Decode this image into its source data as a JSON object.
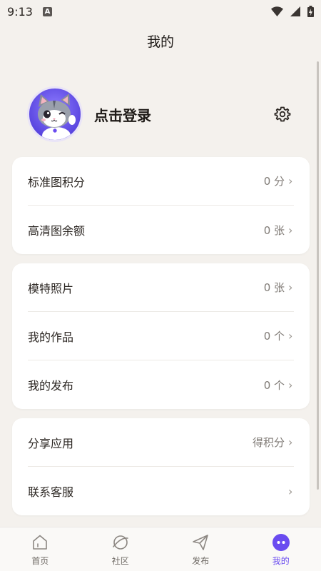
{
  "status": {
    "time": "9:13",
    "notification_letter": "A"
  },
  "header": {
    "title": "我的"
  },
  "profile": {
    "login_label": "点击登录",
    "avatar_icon": "cat-avatar-icon"
  },
  "cards": [
    {
      "rows": [
        {
          "label": "标准图积分",
          "value": "0 分"
        },
        {
          "label": "高清图余额",
          "value": "0 张"
        }
      ]
    },
    {
      "rows": [
        {
          "label": "模特照片",
          "value": "0 张"
        },
        {
          "label": "我的作品",
          "value": "0 个"
        },
        {
          "label": "我的发布",
          "value": "0 个"
        }
      ]
    },
    {
      "rows": [
        {
          "label": "分享应用",
          "value": "得积分"
        },
        {
          "label": "联系客服",
          "value": ""
        }
      ]
    }
  ],
  "chevron": "›",
  "nav": {
    "items": [
      {
        "label": "首页",
        "icon": "home-icon"
      },
      {
        "label": "社区",
        "icon": "planet-icon"
      },
      {
        "label": "发布",
        "icon": "send-icon"
      },
      {
        "label": "我的",
        "icon": "profile-bot-icon"
      }
    ],
    "active_color": "#6a4cf0"
  }
}
